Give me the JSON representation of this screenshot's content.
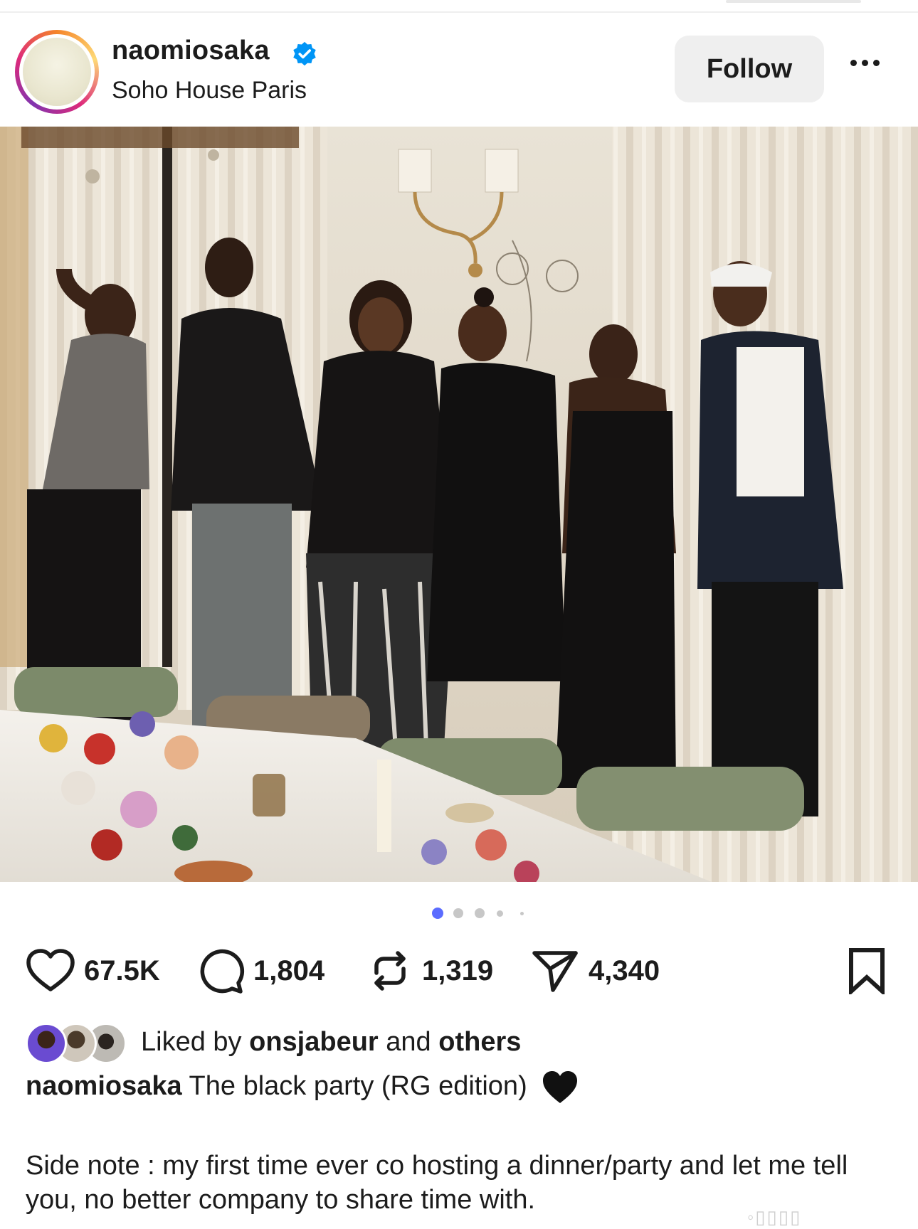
{
  "header": {
    "username": "naomiosaka",
    "location": "Soho House Paris",
    "follow_label": "Follow"
  },
  "photo": {
    "description_icon": "group-photo"
  },
  "carousel": {
    "total": 5,
    "active_index": 0
  },
  "actions": {
    "likes": "67.5K",
    "comments": "1,804",
    "reposts": "1,319",
    "shares": "4,340"
  },
  "liked_by": {
    "prefix": "Liked by",
    "user": "onsjabeur",
    "middle": "and",
    "suffix": "others"
  },
  "caption": {
    "username": "naomiosaka",
    "text": "The black party (RG edition)",
    "emoji": "black-heart-icon"
  },
  "note": "Side note : my first time ever co hosting a dinner/party and let me tell you, no better company to share time with.",
  "colors": {
    "verified": "#0095f6",
    "active_dot": "#5b6cff",
    "text": "#1c1c1c"
  }
}
